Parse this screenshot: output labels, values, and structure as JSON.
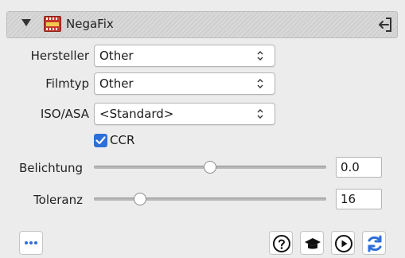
{
  "header": {
    "title": "NegaFix",
    "app_icon": "negafix-film-icon",
    "collapse_icon": "disclosure-triangle-icon",
    "exit_icon": "exit-panel-icon"
  },
  "fields": {
    "hersteller": {
      "label": "Hersteller",
      "value": "Other"
    },
    "filmtyp": {
      "label": "Filmtyp",
      "value": "Other"
    },
    "iso": {
      "label": "ISO/ASA",
      "value": "<Standard>"
    }
  },
  "ccr": {
    "label": "CCR",
    "checked": true
  },
  "belichtung": {
    "label": "Belichtung",
    "value": "0.0",
    "slider_fraction": 0.5
  },
  "toleranz": {
    "label": "Toleranz",
    "value": "16",
    "slider_fraction": 0.18
  },
  "toolbar": {
    "more_icon": "more-dots-icon",
    "help_icon": "help-icon",
    "learn_icon": "graduation-cap-icon",
    "play_icon": "play-icon",
    "refresh_icon": "refresh-icon"
  },
  "colors": {
    "accent": "#2e6ed8",
    "background": "#ececec"
  }
}
